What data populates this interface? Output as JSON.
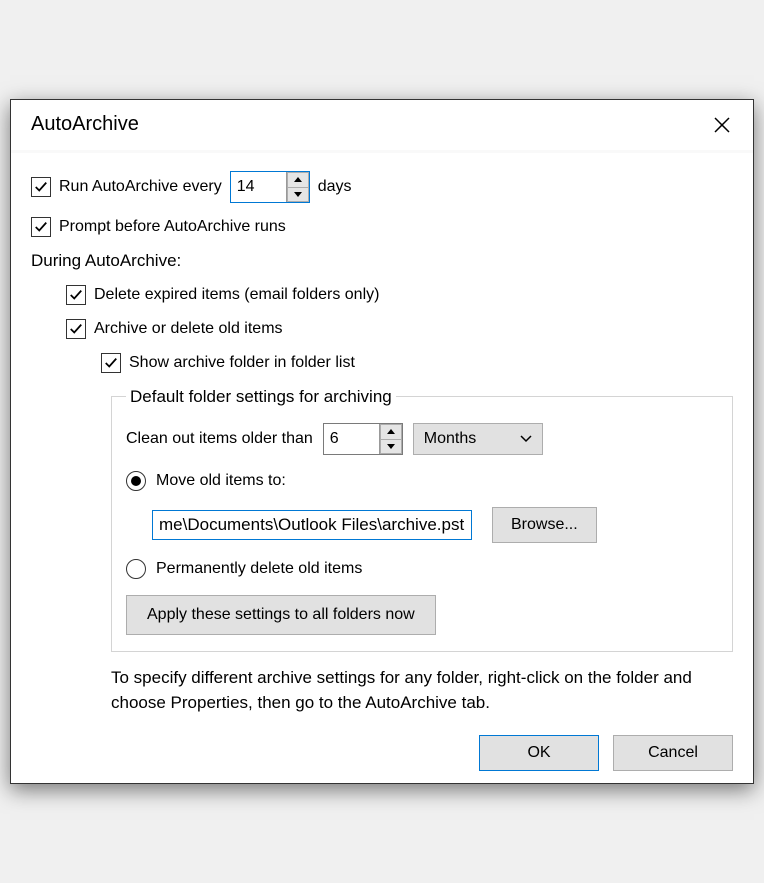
{
  "dialog": {
    "title": "AutoArchive"
  },
  "run": {
    "label_pre": "Run AutoArchive every",
    "value": "14",
    "label_post": "days"
  },
  "prompt": {
    "label": "Prompt before AutoArchive runs"
  },
  "sectionLabel": "During AutoArchive:",
  "deleteExpired": {
    "label": "Delete expired items (email folders only)"
  },
  "archiveOld": {
    "label": "Archive or delete old items"
  },
  "showFolder": {
    "label": "Show archive folder in folder list"
  },
  "fieldset": {
    "legend": "Default folder settings for archiving",
    "cleanOut": {
      "label": "Clean out items older than",
      "value": "6",
      "unit": "Months"
    },
    "moveOld": {
      "label": "Move old items to:",
      "path": "me\\Documents\\Outlook Files\\archive.pst"
    },
    "browse": "Browse...",
    "permDelete": {
      "label": "Permanently delete old items"
    },
    "applyAll": "Apply these settings to all folders now"
  },
  "hint": "To specify different archive settings for any folder, right-click on the folder and choose Properties, then go to the AutoArchive tab.",
  "buttons": {
    "ok": "OK",
    "cancel": "Cancel"
  }
}
